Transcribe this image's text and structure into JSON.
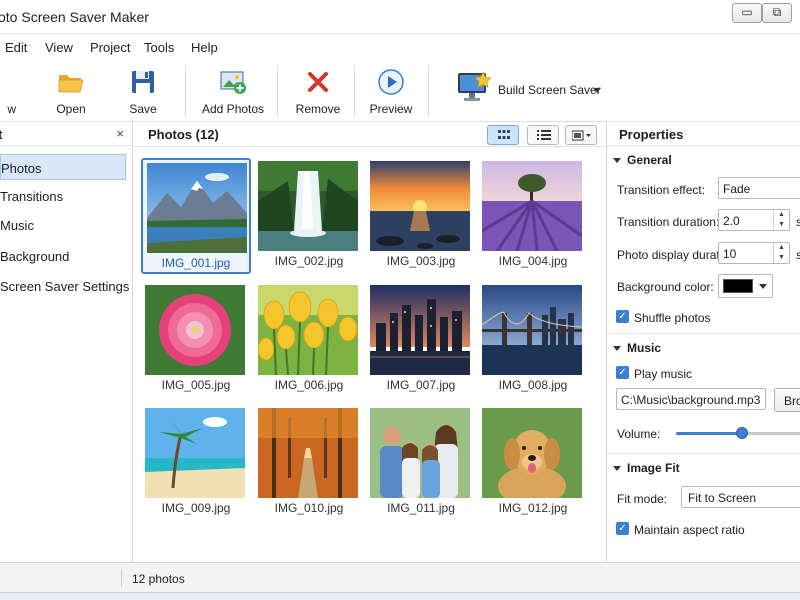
{
  "window": {
    "title": "oto Screen Saver Maker",
    "minimize_glyph": "▭",
    "maximize_glyph": "⧉"
  },
  "menu": [
    "Edit",
    "View",
    "Project",
    "Tools",
    "Help"
  ],
  "toolbar": {
    "new_label": "w",
    "open_label": "Open",
    "save_label": "Save",
    "add_photos_label": "Add Photos",
    "remove_label": "Remove",
    "preview_label": "Preview",
    "build_label": "Build Screen Saver",
    "icons": [
      "new-icon",
      "folder-open-icon",
      "floppy-save-icon",
      "add-photo-icon",
      "remove-x-icon",
      "play-icon",
      "monitor-star-icon",
      "dropdown-arrow-icon"
    ]
  },
  "left_panel": {
    "title": "t",
    "close_glyph": "×",
    "items": [
      "Photos",
      "Transitions",
      "Music",
      "Background",
      "Screen Saver Settings"
    ],
    "active_index": 0
  },
  "center": {
    "title": "Photos  (12)",
    "view_icons": [
      "grid-view-icon",
      "list-view-icon",
      "image-menu-icon"
    ],
    "photos": [
      {
        "name": "IMG_001.jpg",
        "scene": "mountain-lake"
      },
      {
        "name": "IMG_002.jpg",
        "scene": "waterfall"
      },
      {
        "name": "IMG_003.jpg",
        "scene": "sunset-sea"
      },
      {
        "name": "IMG_004.jpg",
        "scene": "lavender-field"
      },
      {
        "name": "IMG_005.jpg",
        "scene": "pink-flower"
      },
      {
        "name": "IMG_006.jpg",
        "scene": "yellow-tulips"
      },
      {
        "name": "IMG_007.jpg",
        "scene": "city-night"
      },
      {
        "name": "IMG_008.jpg",
        "scene": "bridge-city"
      },
      {
        "name": "IMG_009.jpg",
        "scene": "tropical-beach"
      },
      {
        "name": "IMG_010.jpg",
        "scene": "autumn-path"
      },
      {
        "name": "IMG_011.jpg",
        "scene": "family-portrait"
      },
      {
        "name": "IMG_012.jpg",
        "scene": "golden-retriever"
      }
    ],
    "selected_index": 0
  },
  "properties": {
    "title": "Properties",
    "general": {
      "title": "General",
      "transition_effect_label": "Transition effect:",
      "transition_effect_value": "Fade",
      "transition_duration_label": "Transition duration:",
      "transition_duration_value": "2.0",
      "transition_duration_unit": "s",
      "photo_display_label": "Photo display duration:",
      "photo_display_value": "10",
      "photo_display_unit": "s",
      "background_color_label": "Background color:",
      "background_color_value": "#000000",
      "shuffle_label": "Shuffle photos",
      "shuffle_checked": true
    },
    "music": {
      "title": "Music",
      "play_label": "Play music",
      "play_checked": true,
      "file_value": "C:\\Music\\background.mp3",
      "browse_label": "Bro",
      "volume_label": "Volume:",
      "volume_fraction": 0.53
    },
    "image_fit": {
      "title": "Image Fit",
      "fit_mode_label": "Fit mode:",
      "fit_mode_value": "Fit to Screen",
      "maintain_label": "Maintain aspect ratio",
      "maintain_checked": true
    }
  },
  "status": {
    "text": "12 photos"
  },
  "colors": {
    "accent": "#3c7fd1",
    "selection": "#d9e8f8"
  }
}
